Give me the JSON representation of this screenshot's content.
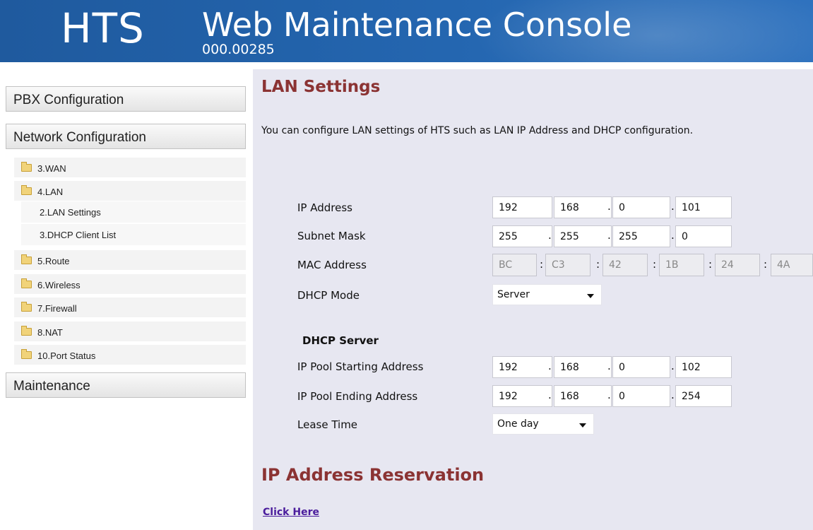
{
  "header": {
    "brand": "HTS",
    "title": "Web Maintenance Console",
    "version": "000.00285"
  },
  "sidebar": {
    "menus": {
      "pbx": "PBX Configuration",
      "network": "Network Configuration",
      "maintenance": "Maintenance"
    },
    "tree": [
      {
        "label": "3.WAN"
      },
      {
        "label": "4.LAN"
      },
      {
        "label": "5.Route"
      },
      {
        "label": "6.Wireless"
      },
      {
        "label": "7.Firewall"
      },
      {
        "label": "8.NAT"
      },
      {
        "label": "10.Port Status"
      }
    ],
    "lan_children": [
      {
        "label": "2.LAN Settings"
      },
      {
        "label": "3.DHCP Client List"
      }
    ]
  },
  "main": {
    "title": "LAN Settings",
    "description": "You can configure LAN settings of HTS such as LAN IP Address and DHCP configuration.",
    "labels": {
      "ip_address": "IP Address",
      "subnet_mask": "Subnet Mask",
      "mac_address": "MAC Address",
      "dhcp_mode": "DHCP Mode",
      "dhcp_server": "DHCP Server",
      "pool_start": "IP Pool Starting Address",
      "pool_end": "IP Pool Ending Address",
      "lease_time": "Lease Time"
    },
    "ip_address": [
      "192",
      "168",
      "0",
      "101"
    ],
    "subnet_mask": [
      "255",
      "255",
      "255",
      "0"
    ],
    "mac_address": [
      "BC",
      "C3",
      "42",
      "1B",
      "24",
      "4A"
    ],
    "dhcp_mode": "Server",
    "pool_start": [
      "192",
      "168",
      "0",
      "102"
    ],
    "pool_end": [
      "192",
      "168",
      "0",
      "254"
    ],
    "lease_time": "One day",
    "separators": {
      "dot": ".",
      "colon": ":"
    },
    "reservation_title": "IP Address Reservation",
    "click_here": "Click Here"
  },
  "colors": {
    "header_blue": "#2466b0",
    "heading_red": "#8b3333",
    "panel_bg": "#e7e7f1",
    "link_purple": "#4a1c9c"
  }
}
